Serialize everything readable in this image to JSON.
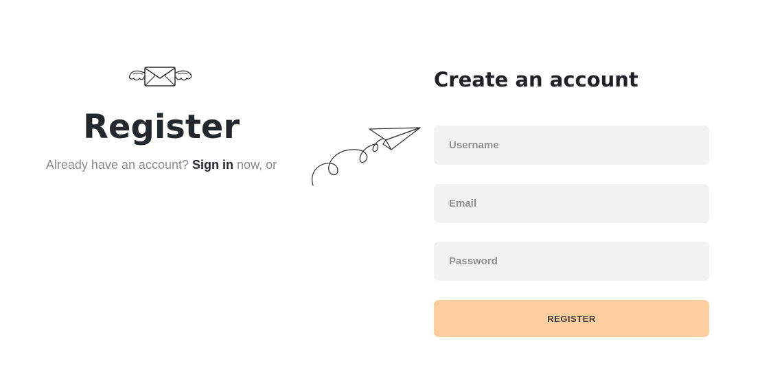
{
  "left": {
    "icon": "winged-envelope-icon",
    "title": "Register",
    "prompt_prefix": "Already have an account? ",
    "signin_link": "Sign in",
    "prompt_suffix": " now, or"
  },
  "decoration": {
    "icon": "paper-plane-icon"
  },
  "form": {
    "title": "Create an account",
    "username_placeholder": "Username",
    "email_placeholder": "Email",
    "password_placeholder": "Password",
    "submit_label": "REGISTER"
  },
  "colors": {
    "text_dark": "#24272b",
    "text_muted": "#8a8a8a",
    "input_bg": "#f2f2f2",
    "button_bg": "#fecea1"
  }
}
